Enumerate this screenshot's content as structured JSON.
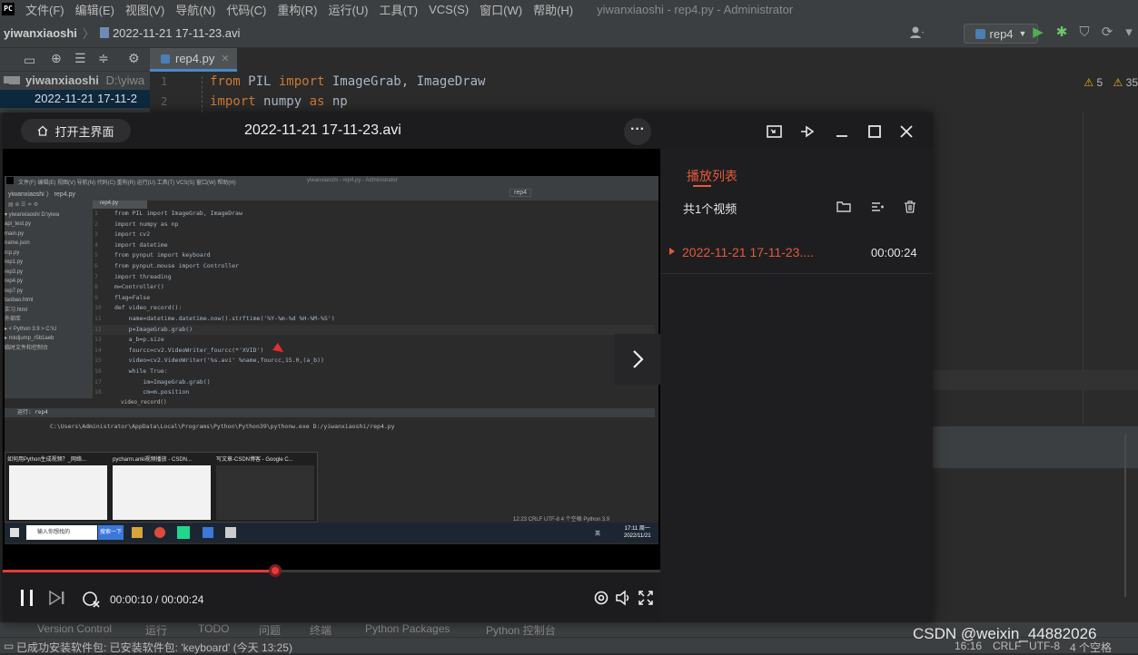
{
  "ide": {
    "menu": [
      "文件(F)",
      "编辑(E)",
      "视图(V)",
      "导航(N)",
      "代码(C)",
      "重构(R)",
      "运行(U)",
      "工具(T)",
      "VCS(S)",
      "窗口(W)",
      "帮助(H)"
    ],
    "window_title": "yiwanxiaoshi - rep4.py - Administrator",
    "breadcrumb_project": "yiwanxiaoshi",
    "breadcrumb_file": "2022-11-21 17-11-23.avi",
    "run_config": "rep4",
    "tree_root": "yiwanxiaoshi",
    "tree_root_path": "D:\\yiwa",
    "tree_selected": "2022-11-21 17-11-2",
    "editor_tab": "rep4.py",
    "code_lines": [
      {
        "n": "1",
        "kw1": "from",
        "mid": " PIL ",
        "kw2": "import",
        "rest": " ImageGrab, ImageDraw"
      },
      {
        "n": "2",
        "kw1": "import",
        "mid": " numpy ",
        "kw2": "as",
        "rest": " np"
      }
    ],
    "warnings": "5",
    "warnings2": "35",
    "bottom_tabs": [
      "Version Control",
      "运行",
      "TODO",
      "问题",
      "终端",
      "Python Packages",
      "Python 控制台"
    ],
    "status_message": "已成功安装软件包: 已安装软件包: 'keyboard' (今天 13:25)",
    "status_right": {
      "pos": "16:16",
      "eol": "CRLF",
      "enc": "UTF-8",
      "indent": "4 个空格"
    },
    "watermark": "CSDN @weixin_44882026"
  },
  "player": {
    "home_label": "打开主界面",
    "title": "2022-11-21 17-11-23.avi",
    "more": "···",
    "progress": 0.414,
    "time_current": "00:00:10",
    "time_total": "00:00:24",
    "time_sep": " / ",
    "accent": "#e5393a"
  },
  "playlist": {
    "title": "播放列表",
    "count": "共1个视频",
    "items": [
      {
        "name": "2022-11-21 17-11-23....",
        "duration": "00:00:24"
      }
    ]
  },
  "frame": {
    "menu": "文件(F)  编辑(E)  视图(V)  导航(N)  代码(C)  重构(R)  运行(U)  工具(T)  VCS(S)  窗口(W)  帮助(H)",
    "title": "yiwanxiaoshi - rep4.py - Administrator",
    "crumb": "yiwanxiaoshi  〉 rep4.py",
    "run_config": "rep4",
    "tab": "rep4.py",
    "tree": [
      "▾ yiwanxiaoshi  D:\\yiwa",
      "     api_test.py",
      "     main.py",
      "     name.json",
      "     rcp.py",
      "     rep1.py",
      "     rep3.py",
      "     rep4.py",
      "     rep7.py",
      "     taobao.html",
      "     实习.html",
      "  外部库",
      "  ▸ < Python 3.9 >  C:\\U",
      "  ▸ mkdjump_r5b1aeb",
      "  临时文件和控制台"
    ],
    "code": [
      [
        "1",
        "",
        "from PIL import ImageGrab, ImageDraw"
      ],
      [
        "2",
        "",
        "import numpy as np"
      ],
      [
        "3",
        "",
        "import cv2"
      ],
      [
        "4",
        "",
        "import datetime"
      ],
      [
        "5",
        "",
        "from pynput import keyboard"
      ],
      [
        "6",
        "",
        "from pynput.mouse import Controller"
      ],
      [
        "7",
        "",
        "import threading"
      ],
      [
        "8",
        "",
        "m=Controller()"
      ],
      [
        "9",
        "",
        "flag=False"
      ],
      [
        "10",
        "",
        "def video_record():"
      ],
      [
        "11",
        "",
        "    name=datetime.datetime.now().strftime('%Y-%m-%d %H-%M-%S')"
      ],
      [
        "12",
        "",
        "    p=ImageGrab.grab()"
      ],
      [
        "13",
        "",
        "    a_b=p.size"
      ],
      [
        "14",
        "",
        "    fourcc=cv2.VideoWriter_fourcc(*'XVID')"
      ],
      [
        "15",
        "",
        "    video=cv2.VideoWriter('%s.avi' %name,fourcc,15.0,(a_b))"
      ],
      [
        "16",
        "",
        "    while True:"
      ],
      [
        "17",
        "",
        "        im=ImageGrab.grab()"
      ],
      [
        "18",
        "",
        "        cm=m.position"
      ]
    ],
    "func_crumb": "video_record()",
    "run_label": "运行:",
    "run_tab": "rep4",
    "run_cmd": "C:\\Users\\Administrator\\AppData\\Local\\Programs\\Python\\Python39\\pythonw.exe D:/yiwanxiaoshi/rep4.py",
    "thumbs": [
      "如何用Python生成视频？_网络...",
      "pycharm.anki视频播放 - CSDN...",
      "写文章-CSDN博客 - Google C..."
    ],
    "search_placeholder": "输入你想找的",
    "search_btn": "搜索一下",
    "status": "12:23   CRLF   UTF-8   4 个空格   Python 3.9",
    "tray_time": "17:11 周一",
    "tray_date": "2022/11/21",
    "tray_lang": "英"
  }
}
